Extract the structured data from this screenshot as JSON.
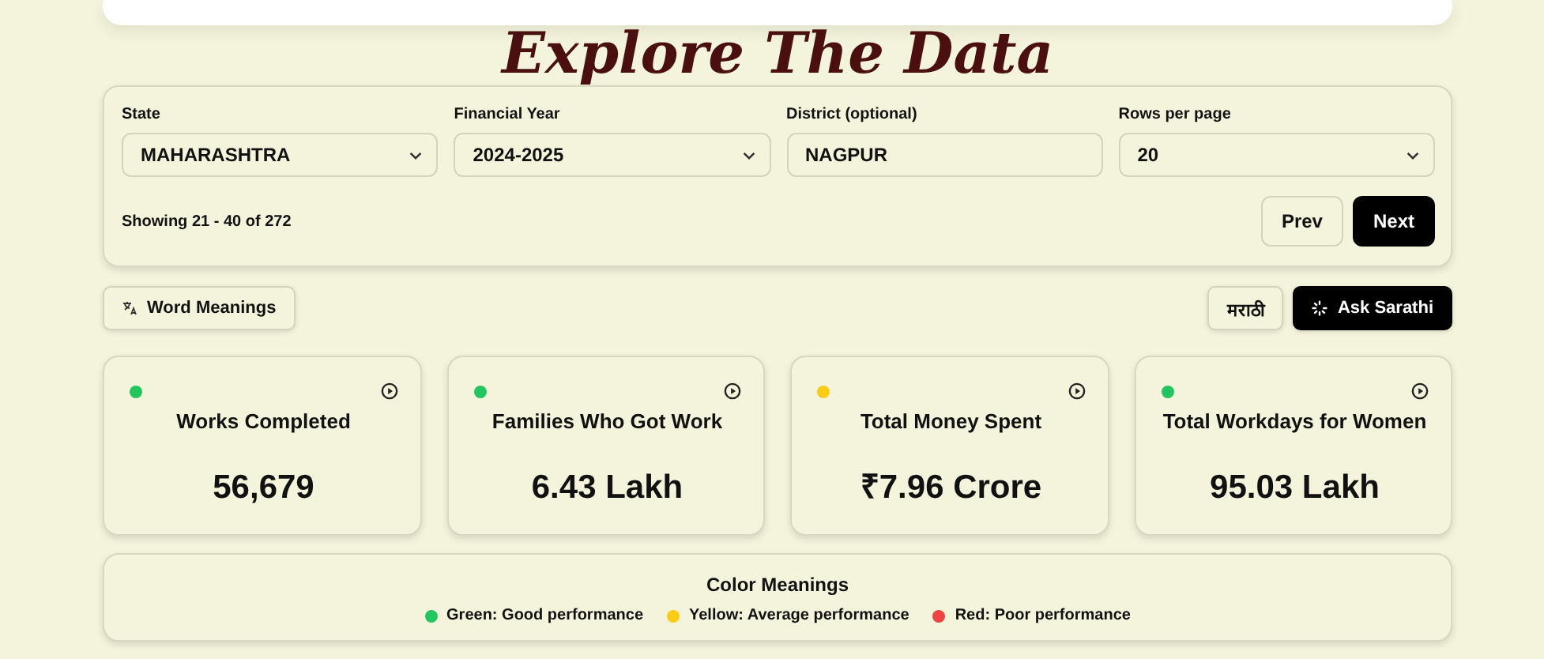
{
  "title": "Explore The Data",
  "filters": [
    {
      "kind": "select",
      "label": "State",
      "value": "MAHARASHTRA"
    },
    {
      "kind": "select",
      "label": "Financial Year",
      "value": "2024-2025"
    },
    {
      "kind": "input",
      "label": "District (optional)",
      "value": "NAGPUR"
    },
    {
      "kind": "select",
      "label": "Rows per page",
      "value": "20"
    }
  ],
  "showing": "Showing 21 - 40 of 272",
  "pager": [
    {
      "label": "Prev",
      "primary": false
    },
    {
      "label": "Next",
      "primary": true
    }
  ],
  "word_meanings": "Word Meanings",
  "language_button": "मराठी",
  "ask_button": "Ask Sarathi",
  "metrics": [
    {
      "label": "Works Completed",
      "value": "56,679",
      "color": "#22c55e"
    },
    {
      "label": "Families Who Got Work",
      "value": "6.43 Lakh",
      "color": "#22c55e"
    },
    {
      "label": "Total Money Spent",
      "value": "₹7.96 Crore",
      "color": "#facc15"
    },
    {
      "label": "Total Workdays for Women",
      "value": "95.03 Lakh",
      "color": "#22c55e"
    }
  ],
  "legend": {
    "title": "Color Meanings",
    "items": [
      {
        "label": "Green: Good performance",
        "color": "#22c55e"
      },
      {
        "label": "Yellow: Average performance",
        "color": "#facc15"
      },
      {
        "label": "Red: Poor performance",
        "color": "#ef4444"
      }
    ]
  }
}
